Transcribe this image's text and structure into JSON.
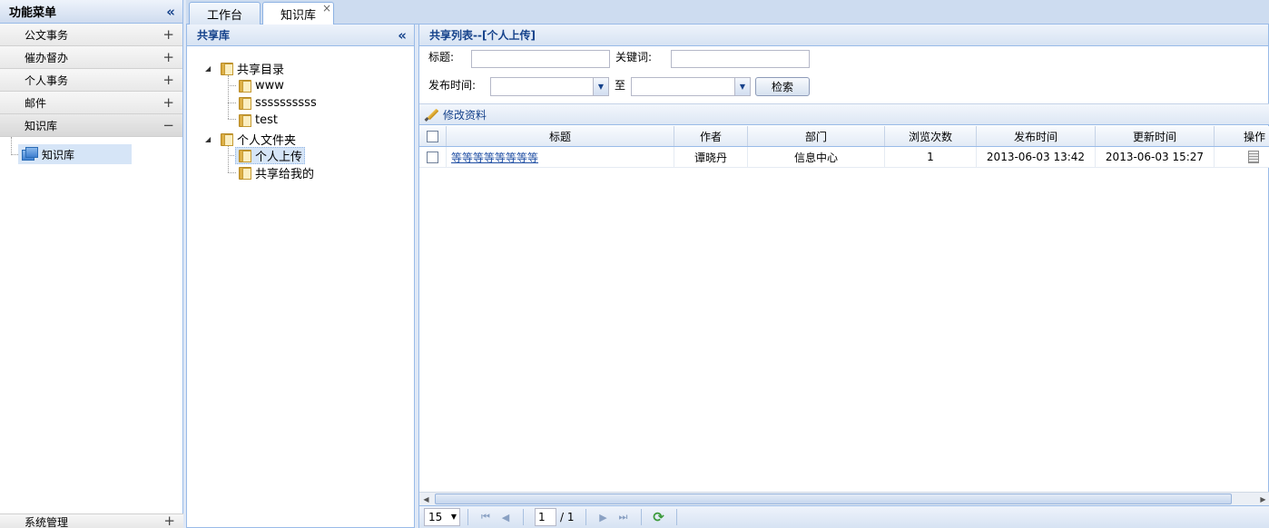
{
  "sidebar": {
    "title": "功能菜单",
    "collapse_icon": "double-chevron-left-icon",
    "sections": [
      {
        "label": "公文事务",
        "state": "+"
      },
      {
        "label": "催办督办",
        "state": "+"
      },
      {
        "label": "个人事务",
        "state": "+"
      },
      {
        "label": "邮件",
        "state": "+"
      },
      {
        "label": "知识库",
        "state": "−"
      }
    ],
    "open_item": "知识库",
    "bottom_section": {
      "label": "系统管理",
      "state": "+"
    }
  },
  "tabs": [
    {
      "label": "工作台",
      "active": false
    },
    {
      "label": "知识库",
      "active": true,
      "close": "×"
    }
  ],
  "tree_panel": {
    "title": "共享库",
    "collapse": "«",
    "nodes": {
      "shared_dir": "共享目录",
      "www": "www",
      "sss": "ssssssssss",
      "test": "test",
      "personal": "个人文件夹",
      "personal_upload": "个人上传",
      "shared_to_me": "共享给我的"
    }
  },
  "list_panel": {
    "title": "共享列表--[个人上传]",
    "form": {
      "title_label": "标题:",
      "title_value": "",
      "keyword_label": "关键词:",
      "keyword_value": "",
      "date_label": "发布时间:",
      "date_from": "",
      "to_label": "至",
      "date_to": "",
      "search_button": "检索"
    },
    "toolbar": {
      "edit_label": "修改资料"
    },
    "columns": [
      "标题",
      "作者",
      "部门",
      "浏览次数",
      "发布时间",
      "更新时间",
      "操作"
    ],
    "rows": [
      {
        "title": "等等等等等等等等",
        "author": "谭晓丹",
        "dept": "信息中心",
        "views": "1",
        "published": "2013-06-03 13:42",
        "updated": "2013-06-03 15:27"
      }
    ],
    "pager": {
      "page_size": "15",
      "current_page": "1",
      "total_pages": "/ 1"
    }
  },
  "colors": {
    "panel_border": "#99bbe8",
    "header_text": "#15428b",
    "selection": "#d6e5f7",
    "link": "#1f4ea3"
  }
}
